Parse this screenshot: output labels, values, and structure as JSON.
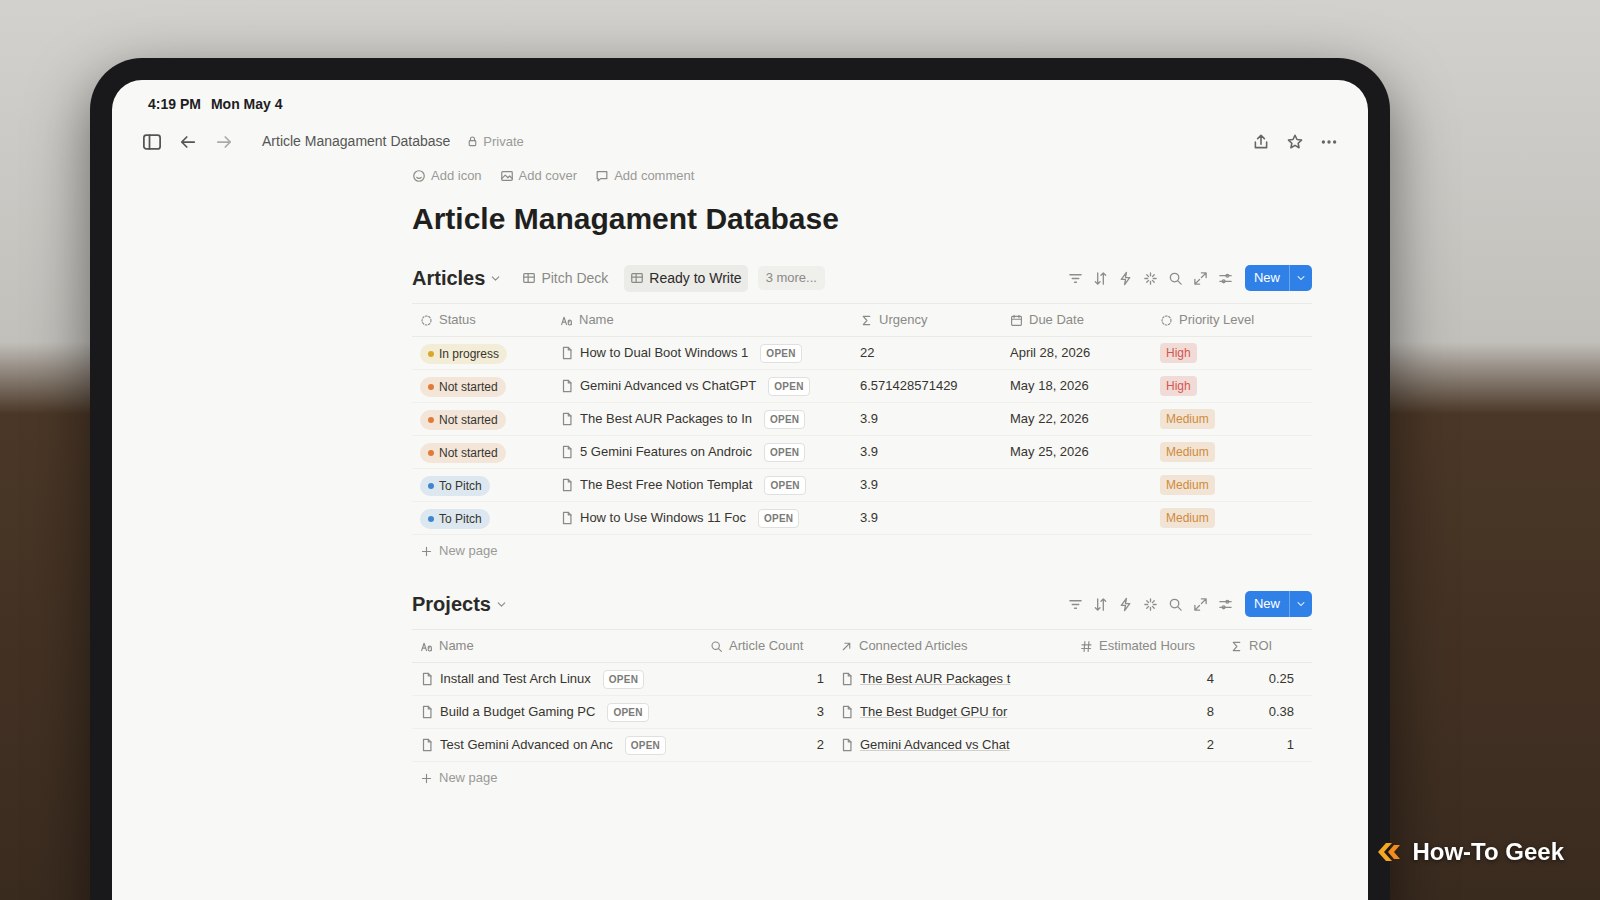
{
  "status_bar": {
    "time": "4:19 PM",
    "date": "Mon May 4"
  },
  "top_bar": {
    "breadcrumb": "Article Managament Database",
    "privacy": "Private"
  },
  "page_actions": [
    "Add icon",
    "Add cover",
    "Add comment"
  ],
  "title": "Article Managament Database",
  "articles": {
    "title": "Articles",
    "views": [
      {
        "label": "Pitch Deck",
        "selected": false
      },
      {
        "label": "Ready to Write",
        "selected": true
      }
    ],
    "more_views": "3 more...",
    "new_button": "New",
    "columns": [
      "Status",
      "Name",
      "Urgency",
      "Due Date",
      "Priority Level"
    ],
    "open_label": "OPEN",
    "rows": [
      {
        "status": "In progress",
        "status_color": "#d9a82b",
        "name": "How to Dual Boot Windows 1",
        "urgency": "22",
        "due": "April 28, 2026",
        "priority": "High",
        "priority_color": "#d4574d"
      },
      {
        "status": "Not started",
        "status_color": "#e07b39",
        "name": "Gemini Advanced vs ChatGPT",
        "urgency": "6.571428571429",
        "due": "May 18, 2026",
        "priority": "High",
        "priority_color": "#d4574d"
      },
      {
        "status": "Not started",
        "status_color": "#e07b39",
        "name": "The Best AUR Packages to In",
        "urgency": "3.9",
        "due": "May 22, 2026",
        "priority": "Medium",
        "priority_color": "#d08a3c"
      },
      {
        "status": "Not started",
        "status_color": "#e07b39",
        "name": "5 Gemini Features on Androic",
        "urgency": "3.9",
        "due": "May 25, 2026",
        "priority": "Medium",
        "priority_color": "#d08a3c"
      },
      {
        "status": "To Pitch",
        "status_color": "#3f86d1",
        "name": "The Best Free Notion Templat",
        "urgency": "3.9",
        "due": "",
        "priority": "Medium",
        "priority_color": "#d08a3c"
      },
      {
        "status": "To Pitch",
        "status_color": "#3f86d1",
        "name": "How to Use Windows 11 Foc",
        "urgency": "3.9",
        "due": "",
        "priority": "Medium",
        "priority_color": "#d08a3c"
      }
    ],
    "new_page": "New page"
  },
  "projects": {
    "title": "Projects",
    "new_button": "New",
    "columns": [
      "Name",
      "Article Count",
      "Connected Articles",
      "Estimated Hours",
      "ROI"
    ],
    "open_label": "OPEN",
    "rows": [
      {
        "name": "Install and Test Arch Linux",
        "count": "1",
        "connected": "The Best AUR Packages t",
        "hours": "4",
        "roi": "0.25"
      },
      {
        "name": "Build a Budget Gaming PC",
        "count": "3",
        "connected": "The Best Budget GPU for",
        "hours": "8",
        "roi": "0.38"
      },
      {
        "name": "Test Gemini Advanced on Anc",
        "count": "2",
        "connected": "Gemini Advanced vs Chat",
        "hours": "2",
        "roi": "1"
      }
    ],
    "new_page": "New page"
  },
  "watermark": "How-To Geek"
}
